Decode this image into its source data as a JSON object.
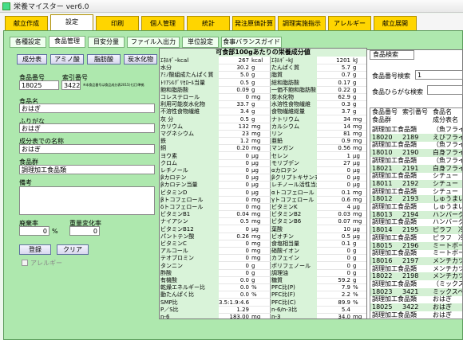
{
  "window": {
    "title": "栄養マイスター ver6.0"
  },
  "main_tabs": [
    "献立作成",
    "設定",
    "印刷",
    "個人管理",
    "統計",
    "発注原価計算",
    "調理実施指示",
    "アレルギー",
    "献立展開"
  ],
  "sub_tabs": [
    "各種設定",
    "食品管理",
    "目安分量",
    "ファイル入出力",
    "単位設定",
    "食事バランスガイド"
  ],
  "category_buttons": [
    "成分表",
    "アミノ酸",
    "脂肪酸",
    "炭水化物"
  ],
  "form": {
    "food_no_label": "食品番号",
    "index_no_label": "索引番号",
    "food_no": "18025",
    "index_no": "3422",
    "note": "※本食品番号は食品成分表2015(七訂)準拠",
    "food_name_label": "食品名",
    "food_name": "おはぎ",
    "furigana_label": "ふりがな",
    "furigana": "おはぎ",
    "product_name_label": "成分表での名称",
    "product_name": "おはぎ",
    "food_group_label": "食品群",
    "food_group": "調理加工食品類",
    "remarks_label": "備考",
    "waste_label": "廃棄率",
    "waste_value": "0",
    "waste_unit": "%",
    "weight_change_label": "重量変化率",
    "weight_change_value": "0",
    "register_button": "登録",
    "clear_button": "クリア",
    "allergy_label": "アレルギー"
  },
  "nutrition": {
    "header": "可食部100gあたりの栄養成分値",
    "left": [
      [
        "ｴﾈﾙｷﾞｰkcal",
        "267",
        "kcal"
      ],
      [
        "水分",
        "30.2",
        "g"
      ],
      [
        "ｱﾐﾉ酸組成たんぱく質",
        "5.0",
        "g"
      ],
      [
        "ﾄﾘｱｼﾙｸﾞﾘｾﾛｰﾙ当量",
        "0.5",
        "g"
      ],
      [
        "飽和脂肪酸",
        "0.09",
        "g"
      ],
      [
        "コレステロール",
        "0",
        "mg"
      ],
      [
        "利用可能炭水化物",
        "33.7",
        "g"
      ],
      [
        "不溶性食物繊維",
        "3.4",
        "g"
      ],
      [
        "灰 分",
        "0.5",
        "g"
      ],
      [
        "カリウム",
        "132",
        "mg"
      ],
      [
        "マグネシウム",
        "23",
        "mg"
      ],
      [
        "鉄",
        "1.2",
        "mg"
      ],
      [
        "銅",
        "0.20",
        "mg"
      ],
      [
        "ヨウ素",
        "0",
        "μg"
      ],
      [
        "クロム",
        "0",
        "μg"
      ],
      [
        "レチノール",
        "0",
        "μg"
      ],
      [
        "βカロテン",
        "0",
        "μg"
      ],
      [
        "βカロテン当量",
        "0",
        "μg"
      ],
      [
        "ビタミンD",
        "0",
        "μg"
      ],
      [
        "βトコフェロール",
        "0",
        "mg"
      ],
      [
        "δトコフェロール",
        "0",
        "mg"
      ],
      [
        "ビタミンB1",
        "0.04",
        "mg"
      ],
      [
        "ナイアシン",
        "0.5",
        "mg"
      ],
      [
        "ビタミンB12",
        "0",
        "μg"
      ],
      [
        "パントテン酸",
        "0.26",
        "mg"
      ],
      [
        "ビタミンC",
        "0",
        "mg"
      ],
      [
        "アルコール",
        "0",
        "mg"
      ],
      [
        "テオブロミン",
        "0",
        "mg"
      ],
      [
        "タンニン",
        "0",
        "g"
      ],
      [
        "酢酸",
        "0",
        "g"
      ],
      [
        "有機酸",
        "0.0",
        "g"
      ],
      [
        "乾燥エネルギー比",
        "0.0",
        "%"
      ],
      [
        "動たんぱく比",
        "0.0",
        "%"
      ],
      [
        "SMP比",
        "3.5:1.9:4.6",
        ""
      ],
      [
        "P／S比",
        "1.29",
        ""
      ],
      [
        "n-6",
        "183.00",
        "mg"
      ]
    ],
    "right": [
      [
        "ｴﾈﾙｷﾞｰkJ",
        "1201",
        "kJ"
      ],
      [
        "たんぱく質",
        "5.7",
        "g"
      ],
      [
        "脂質",
        "0.7",
        "g"
      ],
      [
        "総和脂肪酸",
        "0.17",
        "g"
      ],
      [
        "一価不飽和脂肪酸",
        "0.22",
        "g"
      ],
      [
        "炭水化物",
        "62.9",
        "g"
      ],
      [
        "水溶性食物繊維",
        "0.3",
        "g"
      ],
      [
        "食物繊維総量",
        "3.7",
        "g"
      ],
      [
        "ナトリウム",
        "34",
        "mg"
      ],
      [
        "カルシウム",
        "14",
        "mg"
      ],
      [
        "リン",
        "81",
        "mg"
      ],
      [
        "亜鉛",
        "0.9",
        "mg"
      ],
      [
        "マンガン",
        "0.56",
        "mg"
      ],
      [
        "セレン",
        "1",
        "μg"
      ],
      [
        "モリブデン",
        "27",
        "μg"
      ],
      [
        "αカロテン",
        "0",
        "μg"
      ],
      [
        "βクリプトキサンチン",
        "0",
        "μg"
      ],
      [
        "レチノール活性当量",
        "0",
        "μg"
      ],
      [
        "αトコフェロール",
        "0.1",
        "mg"
      ],
      [
        "γトコフェロール",
        "0.6",
        "mg"
      ],
      [
        "ビタミンK",
        "4",
        "μg"
      ],
      [
        "ビタミンB2",
        "0.03",
        "mg"
      ],
      [
        "ビタミンB6",
        "0.07",
        "mg"
      ],
      [
        "葉酸",
        "10",
        "μg"
      ],
      [
        "ビオチン",
        "0.5",
        "μg"
      ],
      [
        "食塩相当量",
        "0.1",
        "g"
      ],
      [
        "硝酸イオン",
        "0",
        "g"
      ],
      [
        "カフェイン",
        "0",
        "g"
      ],
      [
        "ポリフェノール",
        "0",
        "g"
      ],
      [
        "調理油",
        "0",
        "g"
      ],
      [
        "糖質",
        "59.2",
        "g"
      ],
      [
        "PFC比(P)",
        "7.9",
        "%"
      ],
      [
        "PFC比(F)",
        "2.2",
        "%"
      ],
      [
        "PFC比(C)",
        "89.9",
        "%"
      ],
      [
        "n-6/n-3比",
        "5.4",
        ""
      ],
      [
        "n-3",
        "34.0",
        "mg"
      ]
    ]
  },
  "search": {
    "tab_label": "食品検索",
    "food_no_search_label": "食品番号検索",
    "food_no_search_value": "1",
    "furigana_search_label": "食品ひらがな検索",
    "list_header": [
      "食品番号",
      "索引番号",
      "食品名"
    ],
    "list_header2": [
      "食品群",
      "",
      "成分表名"
    ],
    "rows": [
      [
        "調理加工食品類",
        "",
        "（魚フライ"
      ],
      [
        "18020",
        "2189",
        "えびフライ"
      ],
      [
        "調理加工食品類",
        "",
        "（魚フライ"
      ],
      [
        "18010",
        "2190",
        "白身フライ"
      ],
      [
        "調理加工食品類",
        "",
        "（魚フライ"
      ],
      [
        "18021",
        "2191",
        "白身フライ"
      ],
      [
        "調理加工食品類",
        "",
        "シチュー"
      ],
      [
        "18011",
        "2192",
        "シチュー"
      ],
      [
        "調理加工食品類",
        "",
        "シチュー"
      ],
      [
        "18012",
        "2193",
        "しゅうまい"
      ],
      [
        "調理加工食品類",
        "",
        "しゅうまい"
      ],
      [
        "18013",
        "2194",
        "ハンバーグ"
      ],
      [
        "調理加工食品類",
        "",
        "ハンバーグ"
      ],
      [
        "18014",
        "2195",
        "ピラフ　冷凍"
      ],
      [
        "調理加工食品類",
        "",
        "ピラフ　冷凍"
      ],
      [
        "18015",
        "2196",
        "ミートボール"
      ],
      [
        "調理加工食品類",
        "",
        "ミートボール"
      ],
      [
        "18016",
        "2197",
        "メンチカツ"
      ],
      [
        "調理加工食品類",
        "",
        "メンチカツ"
      ],
      [
        "18022",
        "2198",
        "メンチカツ"
      ],
      [
        "調理加工食品類",
        "",
        "（ミックス"
      ],
      [
        "18023",
        "3421",
        "ミックスベジ"
      ],
      [
        "調理加工食品類",
        "",
        "おはぎ"
      ],
      [
        "18025",
        "3422",
        "おはぎ"
      ],
      [
        "調理加工食品類",
        "",
        "おはぎ"
      ]
    ]
  }
}
